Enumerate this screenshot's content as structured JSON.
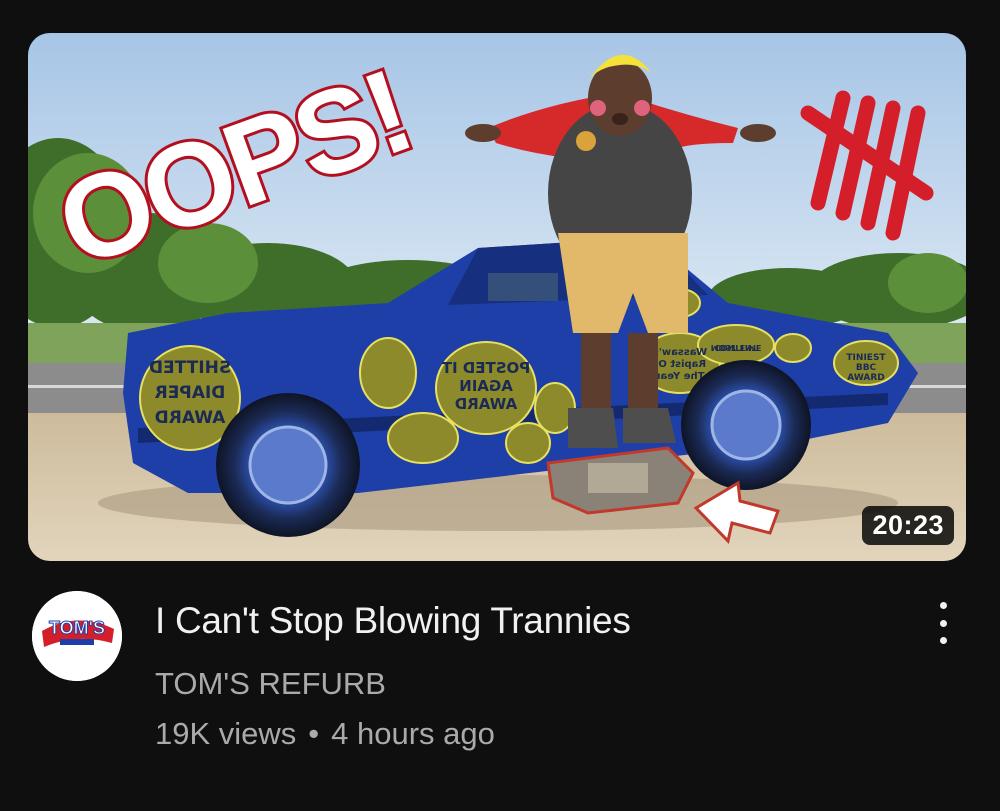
{
  "video": {
    "title": "I Can't Stop Blowing Trannies",
    "duration": "20:23",
    "channel": "TOM'S REFURB",
    "views": "19K views",
    "separator": "•",
    "age": "4 hours ago"
  },
  "thumbnail": {
    "headline": "OOPS!",
    "badges": [
      "SHITTED DIAPER AWARD",
      "POSTED IT AGAIN AWARD",
      "TINIEST BBC AWARD",
      "MOST TIME CONTENT CONSUMED AWARD",
      "Wassaw's Rapist Of The Year Award"
    ]
  },
  "avatar": {
    "logo_text": "TOM'S"
  },
  "colors": {
    "background": "#0f0f0f",
    "title": "#f1f1f1",
    "secondary": "#aaaaaa",
    "car_blue": "#1f3fa8",
    "badge_olive": "#8c8a2a",
    "tally_red": "#d41e2a"
  },
  "icons": [
    "more-vert-icon",
    "arrow-icon"
  ]
}
